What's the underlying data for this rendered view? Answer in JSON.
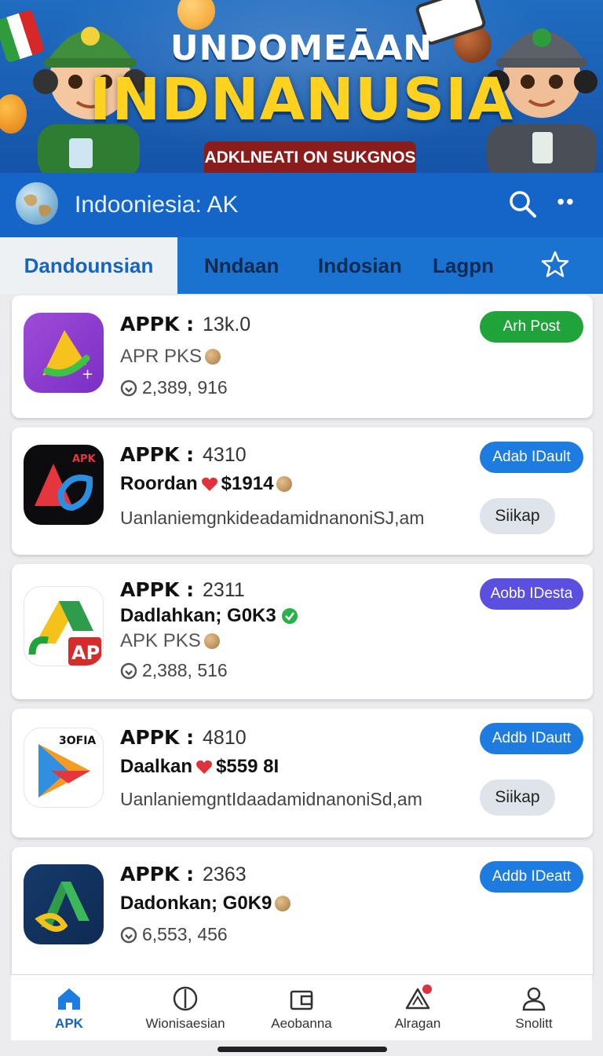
{
  "banner": {
    "subtitle": "UNDOMEĀAN",
    "title": "INDNANUSIA",
    "ribbon": "ADKLNEATI ON SUKGNOS"
  },
  "appbar": {
    "title": "Indooniesia: AK",
    "search_icon": "search-icon",
    "more_icon": "more-horizontal-icon"
  },
  "tabs": [
    {
      "label": "Dandounsian",
      "active": true
    },
    {
      "label": "Nndaan",
      "active": false
    },
    {
      "label": "Indosian",
      "active": false
    },
    {
      "label": "Lagpn",
      "active": false
    }
  ],
  "cards": [
    {
      "title": "APPK :",
      "number": "13k.0",
      "line2": "APR PKS",
      "line3": "2,389, 916",
      "action": "Arh Post",
      "action_color": "#1fa33a"
    },
    {
      "title": "APPK :",
      "number": "4310",
      "line2_a": "Roordan",
      "line2_b": "$1914",
      "line3": "UanlaniemgnkideadamidnanoniSJ,am",
      "action": "Adab IDault",
      "secondary": "Siikap"
    },
    {
      "title": "APPK :",
      "number": "2311",
      "line2": "Dadlahkan; G0K3",
      "line3": "APK PKS",
      "line4": "2,388, 516",
      "action": "Aobb IDesta"
    },
    {
      "title": "APPK :",
      "number": "4810",
      "line2_a": "Daalkan",
      "line2_b": "$559 8I",
      "line3": "UanlaniemgntIdaadamidnanoniSd,am",
      "action": "Addb IDautt",
      "secondary": "Siikap"
    },
    {
      "title": "APPK :",
      "number": "2363",
      "line2": "Dadonkan; G0K9",
      "line3": "6,553, 456",
      "action": "Addb IDeatt"
    }
  ],
  "icon_labels": {
    "card2_tag": "APK",
    "card3_tag": "AP",
    "card4_tag": "3OFIA"
  },
  "bottom_nav": [
    {
      "label": "APK",
      "icon": "home-icon",
      "active": true
    },
    {
      "label": "Wionisaesian",
      "icon": "compass-icon",
      "active": false
    },
    {
      "label": "Aeobanna",
      "icon": "wallet-icon",
      "active": false
    },
    {
      "label": "Alragan",
      "icon": "triangle-icon",
      "active": false
    },
    {
      "label": "Snolitt",
      "icon": "person-icon",
      "active": false
    }
  ]
}
